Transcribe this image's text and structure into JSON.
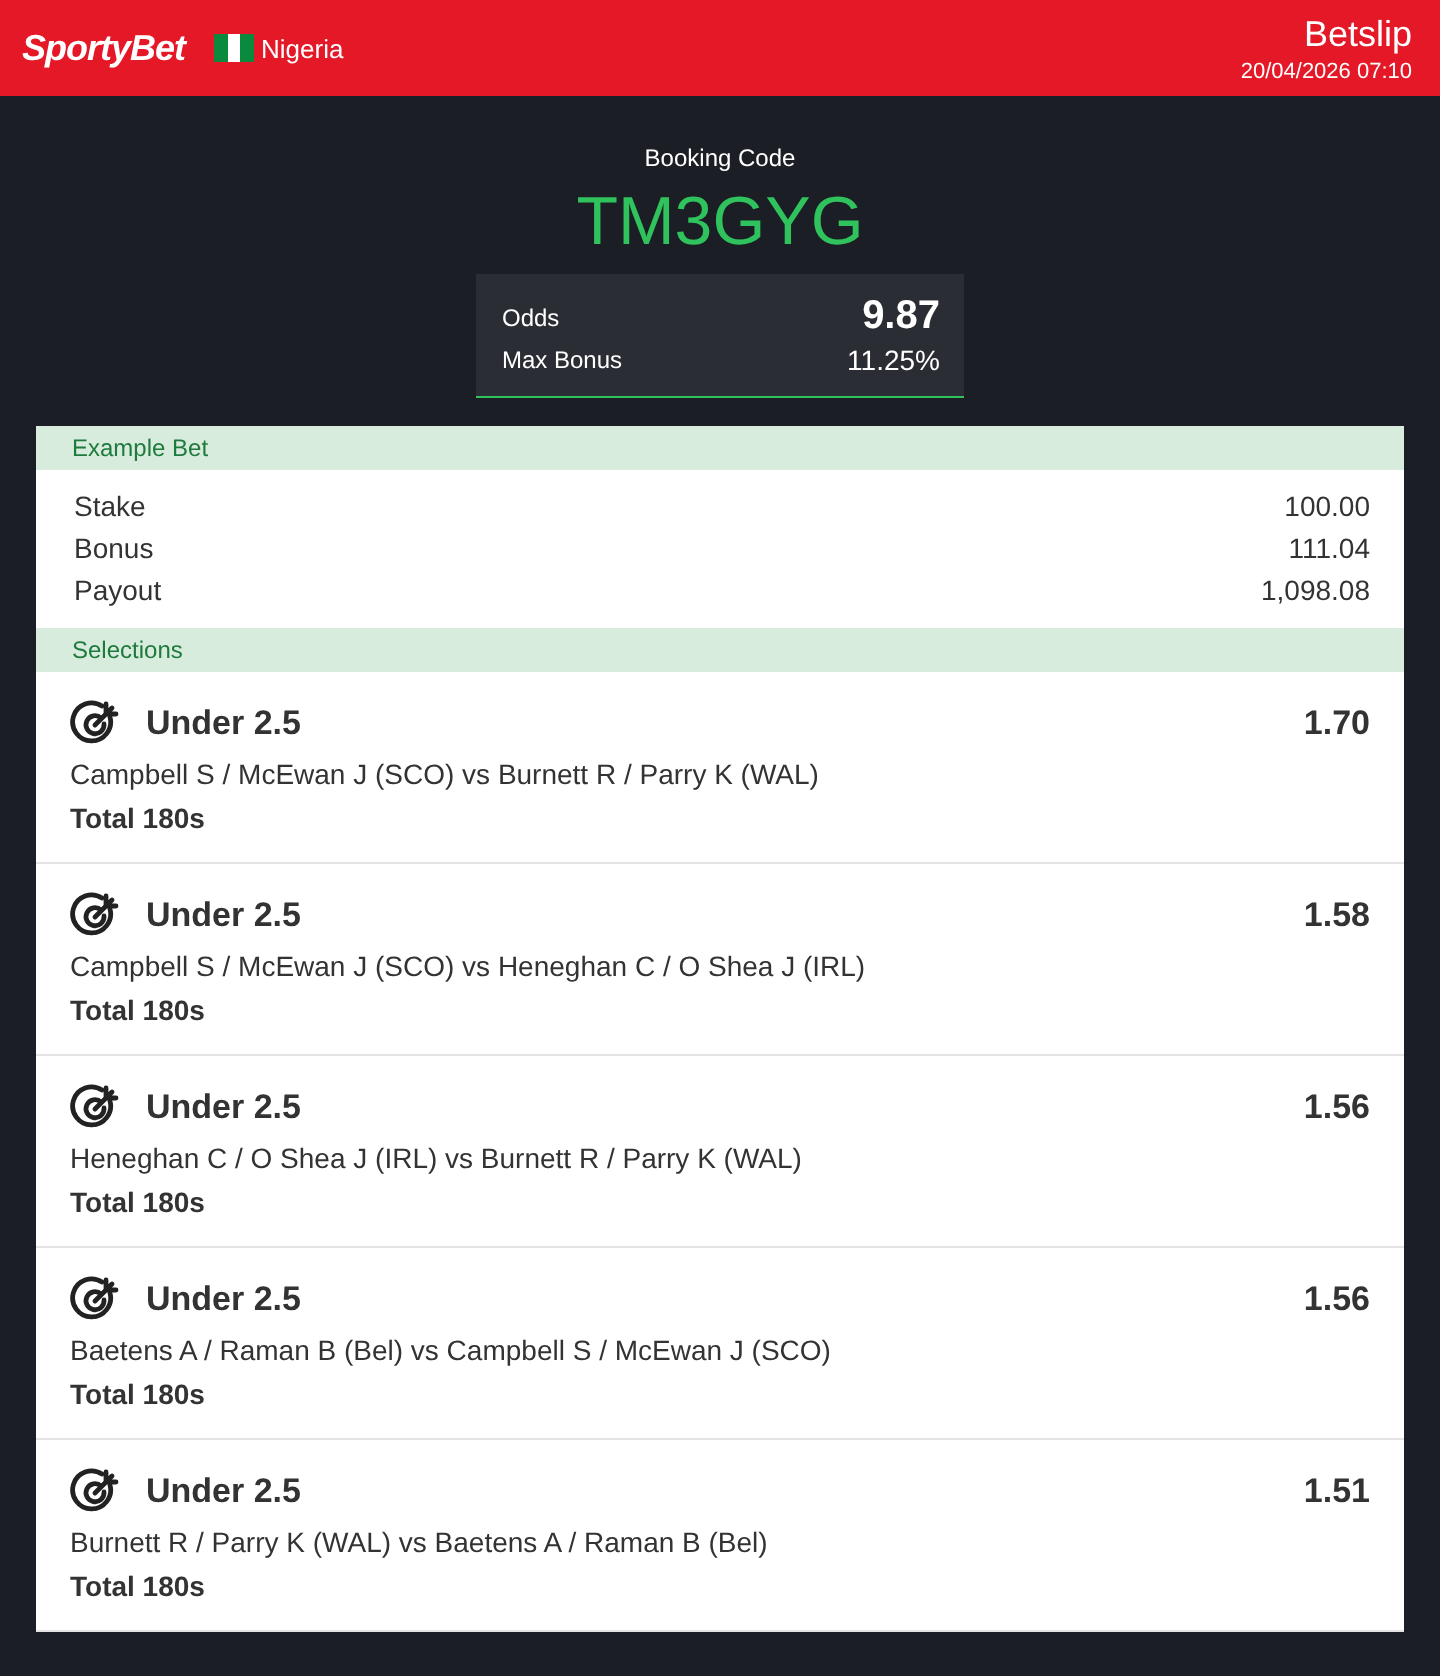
{
  "header": {
    "logo": "SportyBet",
    "country": "Nigeria",
    "title": "Betslip",
    "datetime": "20/04/2026 07:10"
  },
  "booking": {
    "label": "Booking Code",
    "code": "TM3GYG",
    "odds_label": "Odds",
    "odds": "9.87",
    "bonus_label": "Max Bonus",
    "bonus": "11.25%"
  },
  "example_bet": {
    "heading": "Example Bet",
    "rows": [
      {
        "label": "Stake",
        "value": "100.00"
      },
      {
        "label": "Bonus",
        "value": "111.04"
      },
      {
        "label": "Payout",
        "value": "1,098.08"
      }
    ]
  },
  "selections": {
    "heading": "Selections",
    "items": [
      {
        "pick": "Under 2.5",
        "odds": "1.70",
        "event": "Campbell S / McEwan J (SCO) vs Burnett R / Parry K (WAL)",
        "market": "Total 180s"
      },
      {
        "pick": "Under 2.5",
        "odds": "1.58",
        "event": "Campbell S / McEwan J (SCO) vs Heneghan C / O Shea J (IRL)",
        "market": "Total 180s"
      },
      {
        "pick": "Under 2.5",
        "odds": "1.56",
        "event": "Heneghan C / O Shea J (IRL) vs Burnett R / Parry K (WAL)",
        "market": "Total 180s"
      },
      {
        "pick": "Under 2.5",
        "odds": "1.56",
        "event": "Baetens A / Raman B (Bel) vs Campbell S / McEwan J (SCO)",
        "market": "Total 180s"
      },
      {
        "pick": "Under 2.5",
        "odds": "1.51",
        "event": "Burnett R / Parry K (WAL) vs Baetens A / Raman B (Bel)",
        "market": "Total 180s"
      }
    ]
  }
}
